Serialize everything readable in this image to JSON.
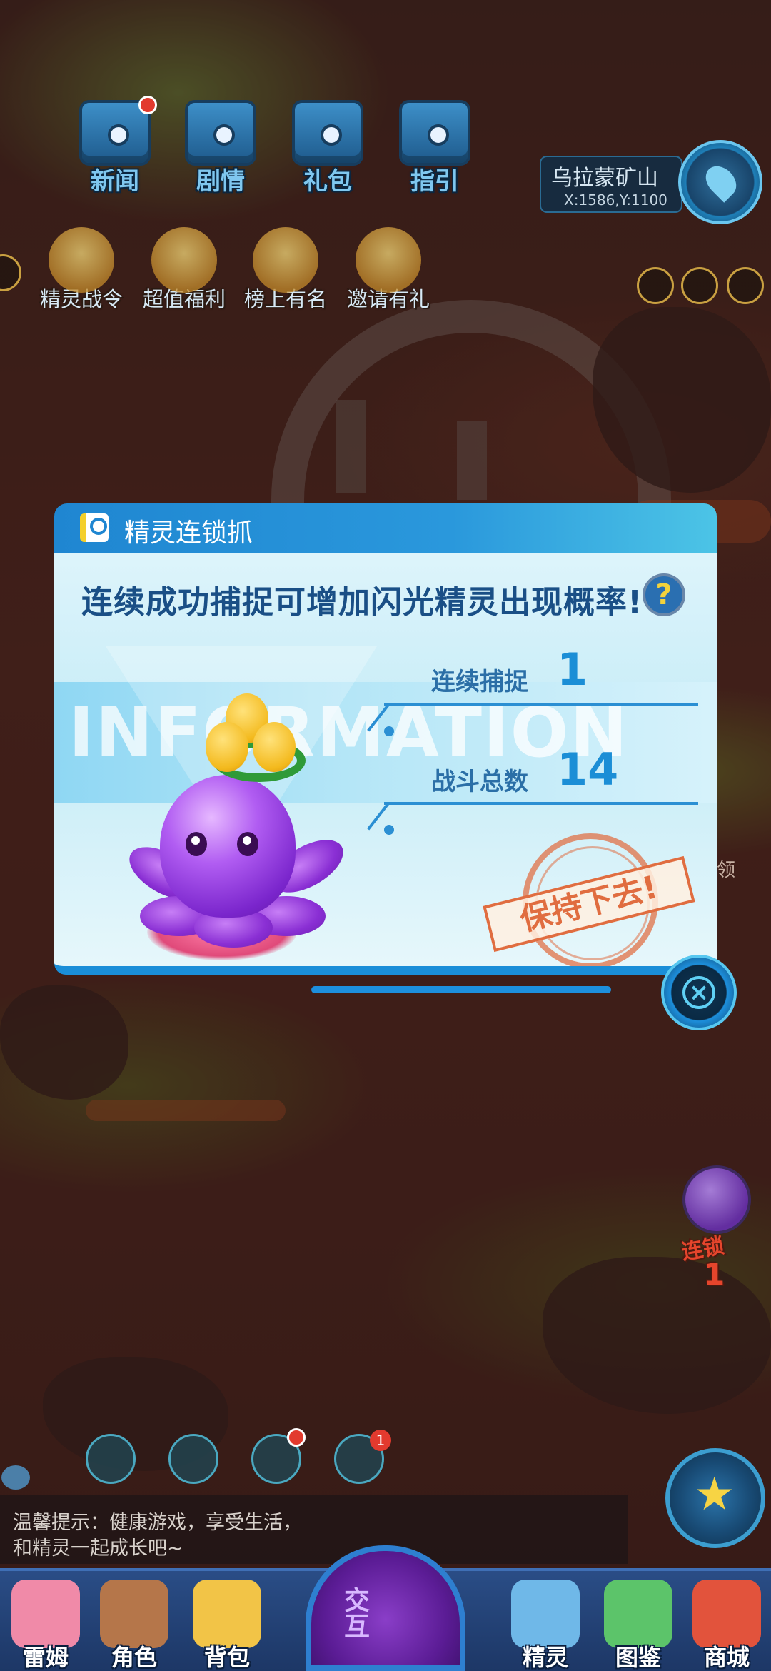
{
  "hud": {
    "top_buttons": [
      {
        "label": "新闻",
        "icon": "news-chest-icon",
        "has_dot": true
      },
      {
        "label": "剧情",
        "icon": "story-chest-icon",
        "has_dot": false
      },
      {
        "label": "礼包",
        "icon": "gift-chest-icon",
        "has_dot": false
      },
      {
        "label": "指引",
        "icon": "guide-chest-icon",
        "has_dot": false
      }
    ],
    "event_buttons": [
      {
        "label": "精灵战令",
        "icon": "battle-pass-icon"
      },
      {
        "label": "超值福利",
        "icon": "welfare-icon"
      },
      {
        "label": "榜上有名",
        "icon": "trophy-icon"
      },
      {
        "label": "邀请有礼",
        "icon": "invite-icon"
      }
    ],
    "location": {
      "name": "乌拉蒙矿山",
      "coords": "X:1586,Y:1100"
    }
  },
  "modal": {
    "title": "精灵连锁抓",
    "headline": "连续成功捕捉可增加闪光精灵出现概率!",
    "help_label": "?",
    "watermark": "INFORMATION",
    "stats": [
      {
        "label": "连续捕捉",
        "value": "1"
      },
      {
        "label": "战斗总数",
        "value": "14"
      }
    ],
    "stamp": "保持下去!",
    "close_icon": "close-icon"
  },
  "side_widget": {
    "label": "连锁",
    "count": "1"
  },
  "side_text": "领",
  "quick_buttons": [
    {
      "icon": "team-icon",
      "badge": ""
    },
    {
      "icon": "compass-icon",
      "badge": ""
    },
    {
      "icon": "pet-face-icon",
      "badge": ""
    },
    {
      "icon": "bell-icon",
      "badge": "1"
    }
  ],
  "tip": {
    "line1": "温馨提示：健康游戏，享受生活，",
    "line2": "和精灵一起成长吧~"
  },
  "bottom_nav": [
    {
      "label": "雷姆",
      "icon": "leimu-icon",
      "color": "#f08aa8"
    },
    {
      "label": "角色",
      "icon": "character-icon",
      "color": "#b5764a"
    },
    {
      "label": "背包",
      "icon": "backpack-icon",
      "color": "#f2c447"
    },
    {
      "label": "精灵",
      "icon": "sprite-icon",
      "color": "#6fb8e8"
    },
    {
      "label": "图鉴",
      "icon": "pokedex-icon",
      "color": "#5cc46a"
    },
    {
      "label": "商城",
      "icon": "shop-icon",
      "color": "#e2533c"
    }
  ],
  "interact_label": "交互"
}
